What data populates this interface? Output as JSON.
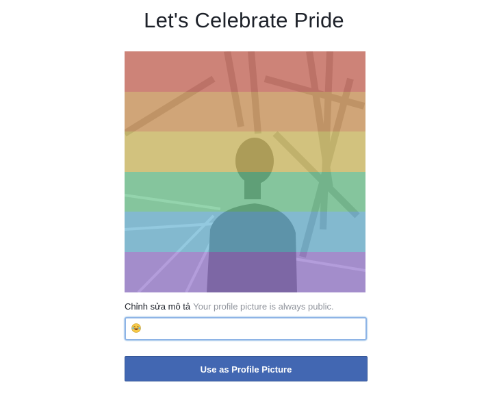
{
  "page": {
    "title": "Let's Celebrate Pride"
  },
  "photo": {
    "overlay": "rainbow-flag-overlay",
    "stripe_colors": [
      "#f47c6b",
      "#f9b36a",
      "#fbe274",
      "#7fe6a6",
      "#7dd3f7",
      "#b08cf0"
    ]
  },
  "caption": {
    "edit_label": "Chỉnh sửa mô tả",
    "note": "Your profile picture is always public."
  },
  "description_input": {
    "emoji_icon": "tears-of-joy-emoji-icon",
    "value": ""
  },
  "actions": {
    "primary_label": "Use as Profile Picture"
  },
  "colors": {
    "button": "#4267b2",
    "input_focus": "#8eb4e6"
  }
}
